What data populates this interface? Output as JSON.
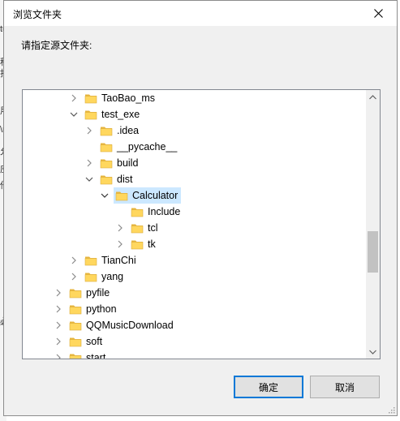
{
  "dialog": {
    "title": "浏览文件夹",
    "prompt": "请指定源文件夹:",
    "ok_label": "确定",
    "cancel_label": "取消"
  },
  "background_fragments": [
    "tu",
    "程",
    "指",
    "用",
    "\\n",
    "允",
    "应",
    "他",
    "必"
  ],
  "tree": {
    "selected": "Calculator",
    "items": [
      {
        "label": "TaoBao_ms",
        "level": 2,
        "toggle": "collapsed"
      },
      {
        "label": "test_exe",
        "level": 2,
        "toggle": "expanded"
      },
      {
        "label": ".idea",
        "level": 3,
        "toggle": "collapsed"
      },
      {
        "label": "__pycache__",
        "level": 3,
        "toggle": "none"
      },
      {
        "label": "build",
        "level": 3,
        "toggle": "collapsed"
      },
      {
        "label": "dist",
        "level": 3,
        "toggle": "expanded"
      },
      {
        "label": "Calculator",
        "level": 4,
        "toggle": "expanded"
      },
      {
        "label": "Include",
        "level": 5,
        "toggle": "none"
      },
      {
        "label": "tcl",
        "level": 5,
        "toggle": "collapsed"
      },
      {
        "label": "tk",
        "level": 5,
        "toggle": "collapsed"
      },
      {
        "label": "TianChi",
        "level": 2,
        "toggle": "collapsed"
      },
      {
        "label": "yang",
        "level": 2,
        "toggle": "collapsed"
      },
      {
        "label": "pyfile",
        "level": 1,
        "toggle": "collapsed"
      },
      {
        "label": "python",
        "level": 1,
        "toggle": "collapsed"
      },
      {
        "label": "QQMusicDownload",
        "level": 1,
        "toggle": "collapsed"
      },
      {
        "label": "soft",
        "level": 1,
        "toggle": "collapsed"
      },
      {
        "label": "start",
        "level": 1,
        "toggle": "collapsed"
      }
    ]
  },
  "colors": {
    "selection": "#cce8ff",
    "folder": "#ffd75e",
    "primary_border": "#0078d7"
  }
}
